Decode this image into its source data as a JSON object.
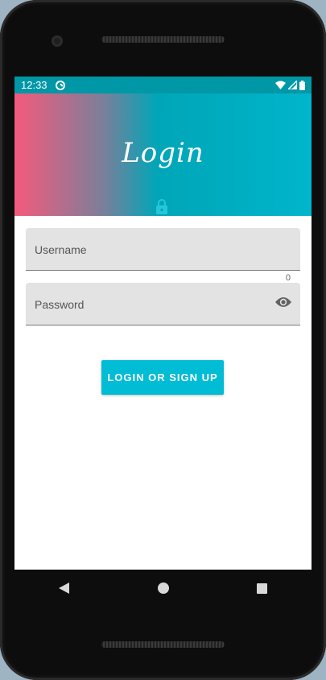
{
  "status_bar": {
    "time": "12:33",
    "icons": [
      "sync-icon",
      "wifi-icon",
      "signal-icon",
      "battery-icon"
    ]
  },
  "header": {
    "title": "Login",
    "icon": "lock-icon"
  },
  "form": {
    "username_label": "Username",
    "username_counter": "0",
    "password_label": "Password",
    "password_toggle_icon": "eye-icon"
  },
  "actions": {
    "login_label": "LOGIN OR SIGN UP"
  },
  "nav": {
    "items": [
      "back-icon",
      "home-icon",
      "recents-icon"
    ]
  },
  "colors": {
    "status_bar": "#0097a7",
    "accent": "#00bcd4",
    "gradient_start": "#f25a7e",
    "gradient_end": "#00b5cc"
  }
}
